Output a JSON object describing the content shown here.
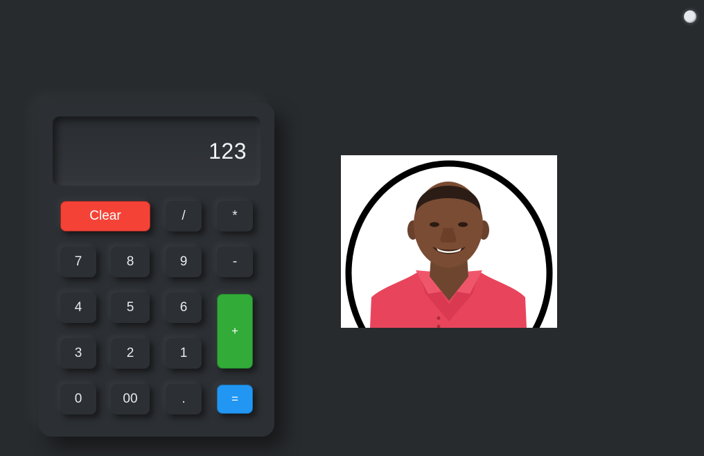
{
  "display": {
    "value": "123"
  },
  "keys": {
    "clear": "Clear",
    "divide": "/",
    "multiply": "*",
    "seven": "7",
    "eight": "8",
    "nine": "9",
    "minus": "-",
    "four": "4",
    "five": "5",
    "six": "6",
    "plus": "+",
    "three": "3",
    "two": "2",
    "one": "1",
    "zero": "0",
    "double_zero": "00",
    "dot": ".",
    "equals": "="
  },
  "colors": {
    "background": "#282b2e",
    "clear": "#f44336",
    "plus": "#32ab38",
    "equals": "#2196f3"
  },
  "icons": {
    "theme_toggle": "circle-toggle-icon",
    "profile": "profile-portrait"
  }
}
